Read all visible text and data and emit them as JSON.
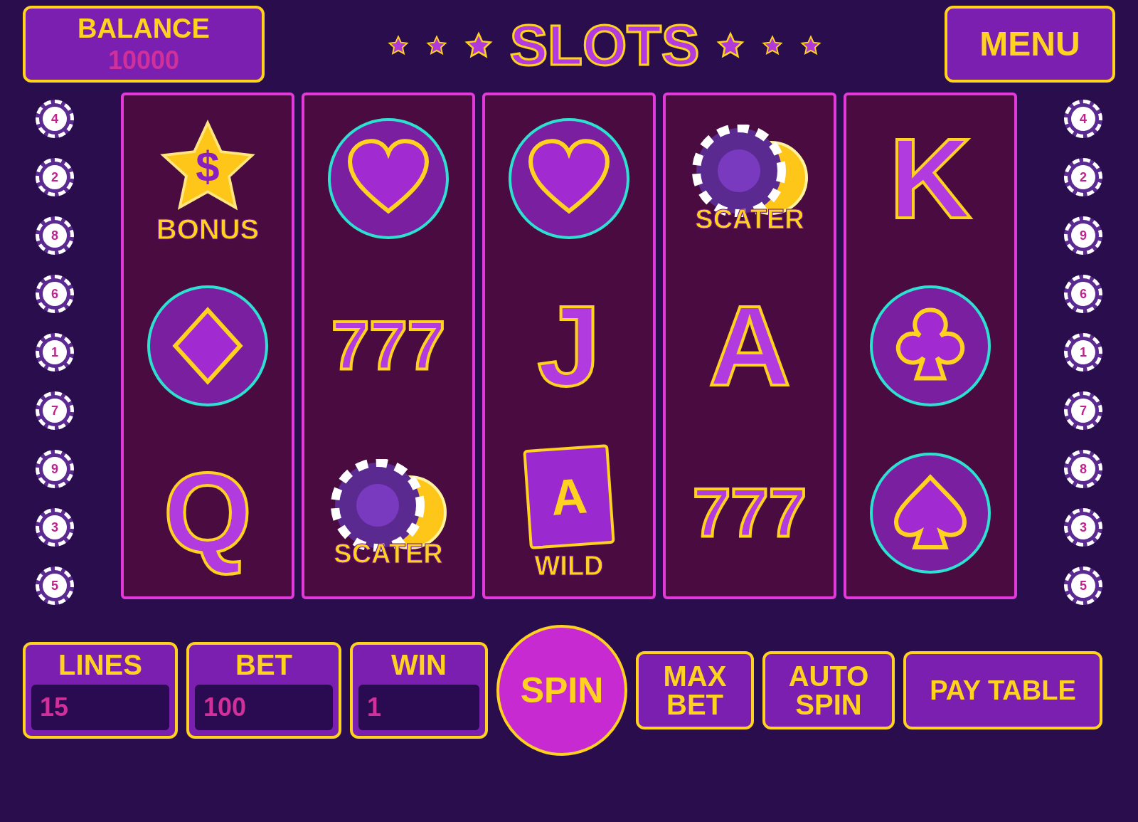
{
  "balance": {
    "label": "BALANCE",
    "value": "10000"
  },
  "title": "SLOTS",
  "menu_button": "MENU",
  "left_chips": [
    "4",
    "2",
    "8",
    "6",
    "1",
    "7",
    "9",
    "3",
    "5"
  ],
  "right_chips": [
    "4",
    "2",
    "9",
    "6",
    "1",
    "7",
    "8",
    "3",
    "5"
  ],
  "reels": [
    [
      {
        "kind": "bonus",
        "glyph": "$",
        "label": "BONUS"
      },
      {
        "kind": "diamond"
      },
      {
        "kind": "letter",
        "letter": "Q"
      }
    ],
    [
      {
        "kind": "heart"
      },
      {
        "kind": "seven",
        "letter": "777"
      },
      {
        "kind": "chips",
        "label": "SCATER"
      }
    ],
    [
      {
        "kind": "heart"
      },
      {
        "kind": "letter",
        "letter": "J"
      },
      {
        "kind": "cards",
        "glyph": "A",
        "label": "WILD"
      }
    ],
    [
      {
        "kind": "chips",
        "label": "SCATER"
      },
      {
        "kind": "letter",
        "letter": "A"
      },
      {
        "kind": "seven",
        "letter": "777"
      }
    ],
    [
      {
        "kind": "letter",
        "letter": "K"
      },
      {
        "kind": "club"
      },
      {
        "kind": "spade"
      }
    ]
  ],
  "stats": [
    {
      "label": "LINES",
      "value": "15"
    },
    {
      "label": "BET",
      "value": "100"
    },
    {
      "label": "WIN",
      "value": "1"
    }
  ],
  "spin_button": "SPIN",
  "buttons": [
    "MAX BET",
    "AUTO SPIN",
    "PAY TABLE"
  ]
}
